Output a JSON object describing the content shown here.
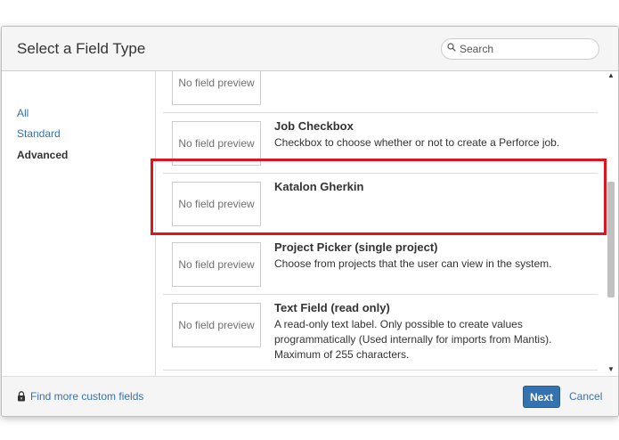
{
  "dialog": {
    "title": "Select a Field Type",
    "search": {
      "placeholder": "Search",
      "value": ""
    }
  },
  "sidebar": {
    "items": [
      {
        "label": "All"
      },
      {
        "label": "Standard"
      },
      {
        "label": "Advanced"
      }
    ]
  },
  "fields": [
    {
      "preview": "No field preview",
      "name": "",
      "description": ""
    },
    {
      "preview": "No field preview",
      "name": "Job Checkbox",
      "description": "Checkbox to choose whether or not to create a Perforce job."
    },
    {
      "preview": "No field preview",
      "name": "Katalon Gherkin",
      "description": ""
    },
    {
      "preview": "No field preview",
      "name": "Project Picker (single project)",
      "description": "Choose from projects that the user can view in the system."
    },
    {
      "preview": "No field preview",
      "name": "Text Field (read only)",
      "description": "A read-only text label. Only possible to create values programmatically (Used internally for imports from Mantis). Maximum of 255 characters."
    }
  ],
  "footer": {
    "find_more": "Find more custom fields",
    "next": "Next",
    "cancel": "Cancel"
  },
  "colors": {
    "accent": "#3572b0",
    "highlight": "#e0141e"
  },
  "icons": [
    "search-icon",
    "lock-icon",
    "scroll-up-arrow-icon",
    "scroll-down-arrow-icon"
  ]
}
